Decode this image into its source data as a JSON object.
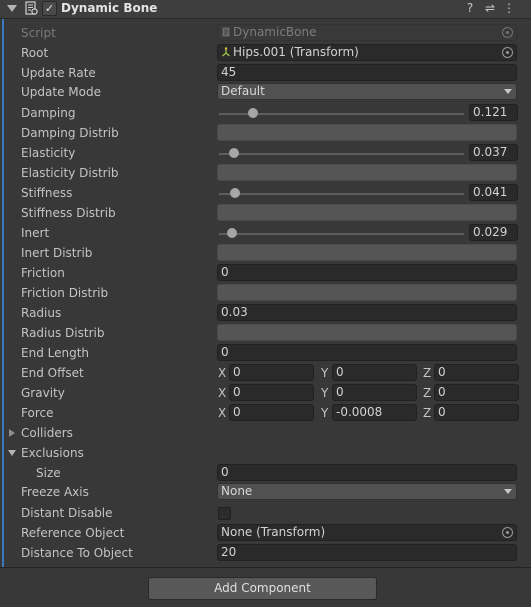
{
  "component": {
    "title": "Dynamic Bone",
    "enabled": "✓",
    "help_icon": "?",
    "presets_icon": "⇌",
    "menu_icon": "⋮"
  },
  "fields": {
    "script": {
      "label": "Script",
      "value": "DynamicBone"
    },
    "root": {
      "label": "Root",
      "value": "Hips.001 (Transform)"
    },
    "update_rate": {
      "label": "Update Rate",
      "value": "45"
    },
    "update_mode": {
      "label": "Update Mode",
      "value": "Default"
    },
    "damping": {
      "label": "Damping",
      "value": "0.121",
      "level": 0.121
    },
    "damping_distrib": {
      "label": "Damping Distrib"
    },
    "elasticity": {
      "label": "Elasticity",
      "value": "0.037",
      "level": 0.037
    },
    "elasticity_distrib": {
      "label": "Elasticity Distrib"
    },
    "stiffness": {
      "label": "Stiffness",
      "value": "0.041",
      "level": 0.041
    },
    "stiffness_distrib": {
      "label": "Stiffness Distrib"
    },
    "inert": {
      "label": "Inert",
      "value": "0.029",
      "level": 0.029
    },
    "inert_distrib": {
      "label": "Inert Distrib"
    },
    "friction": {
      "label": "Friction",
      "value": "0"
    },
    "friction_distrib": {
      "label": "Friction Distrib"
    },
    "radius": {
      "label": "Radius",
      "value": "0.03"
    },
    "radius_distrib": {
      "label": "Radius Distrib"
    },
    "end_length": {
      "label": "End Length",
      "value": "0"
    },
    "end_offset": {
      "label": "End Offset",
      "x": "0",
      "y": "0",
      "z": "0"
    },
    "gravity": {
      "label": "Gravity",
      "x": "0",
      "y": "0",
      "z": "0"
    },
    "force": {
      "label": "Force",
      "x": "0",
      "y": "-0.0008",
      "z": "0"
    },
    "colliders": {
      "label": "Colliders"
    },
    "exclusions": {
      "label": "Exclusions",
      "size_label": "Size",
      "size": "0"
    },
    "freeze_axis": {
      "label": "Freeze Axis",
      "value": "None"
    },
    "distant_disable": {
      "label": "Distant Disable"
    },
    "reference_object": {
      "label": "Reference Object",
      "value": "None (Transform)"
    },
    "distance_to_object": {
      "label": "Distance To Object",
      "value": "20"
    }
  },
  "axis": {
    "x": "X",
    "y": "Y",
    "z": "Z"
  },
  "add_component": "Add Component"
}
